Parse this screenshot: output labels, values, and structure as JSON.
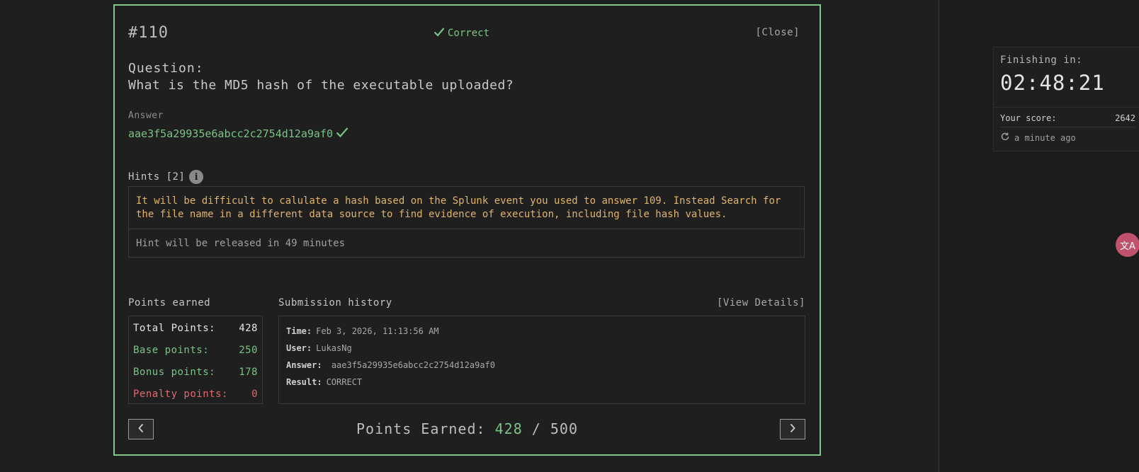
{
  "modal": {
    "id": "#110",
    "status": "Correct",
    "close_label": "[Close]",
    "question_label": "Question:",
    "question_text": "What is the MD5 hash of the executable uploaded?",
    "answer_label": "Answer",
    "answer_value": "aae3f5a29935e6abcc2c2754d12a9af0",
    "hints_title": "Hints [2]",
    "hints": [
      "It will be difficult to calulate a hash based on the Splunk event you used to answer 109. Instead Search for the file name in a different data source to find evidence of execution, including file hash values.",
      "Hint will be released in 49 minutes"
    ],
    "points_earned_label": "Points earned",
    "points": {
      "total_label": "Total Points:",
      "total": "428",
      "base_label": "Base points:",
      "base": "250",
      "bonus_label": "Bonus points:",
      "bonus": "178",
      "penalty_label": "Penalty points:",
      "penalty": "0"
    },
    "submission_history_label": "Submission history",
    "view_details_label": "[View Details]",
    "submission": {
      "time_label": "Time:",
      "time": "Feb 3, 2026, 11:13:56 AM",
      "user_label": "User:",
      "user": "LukasNg",
      "answer_label": "Answer:",
      "answer": "aae3f5a29935e6abcc2c2754d12a9af0",
      "result_label": "Result:",
      "result": "CORRECT"
    },
    "footer": {
      "label": "Points Earned:",
      "earned": "428",
      "sep": "/",
      "max": "500"
    }
  },
  "sidebar": {
    "finishing_label": "Finishing in:",
    "timer": "02:48:21",
    "score_label": "Your score:",
    "score": "2642",
    "updated": "a minute ago"
  },
  "colors": {
    "accent": "#79c485",
    "border": "#7fc88a",
    "hint": "#e0b46a",
    "penalty": "#e06a6a"
  },
  "icons": {
    "status": "check-icon",
    "info": "info-icon",
    "refresh": "refresh-icon",
    "translate": "translate-icon"
  }
}
